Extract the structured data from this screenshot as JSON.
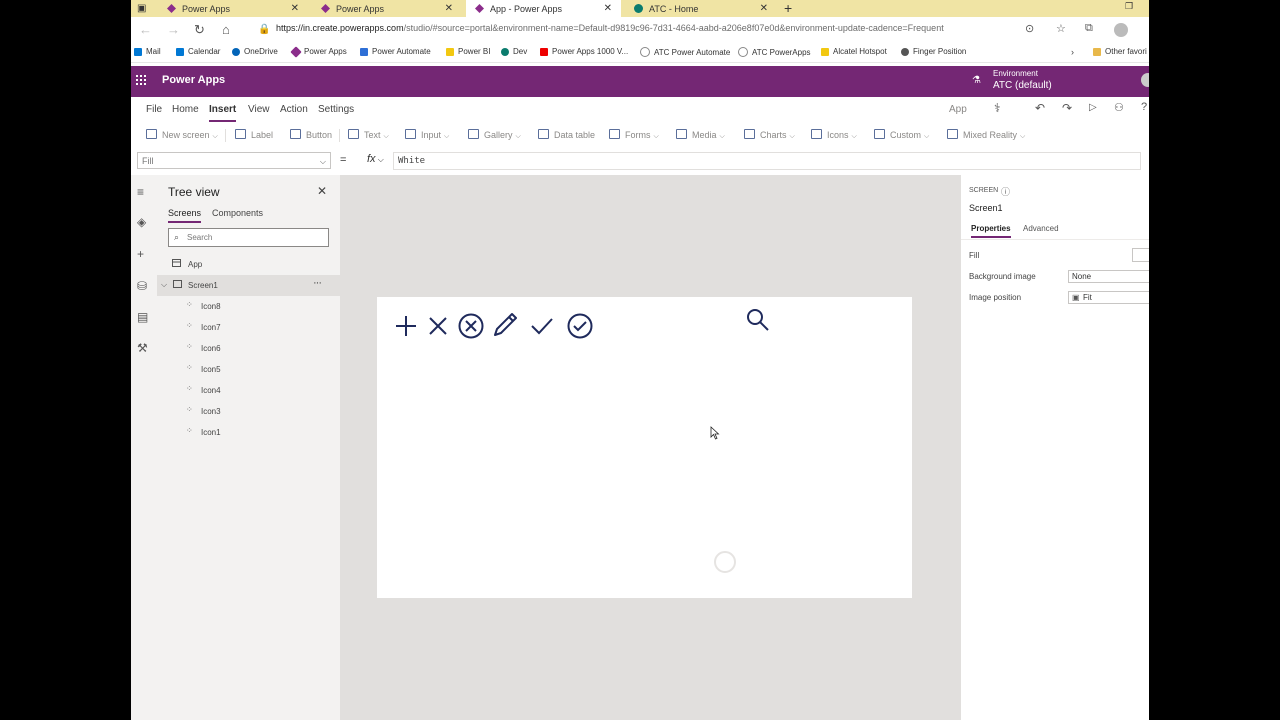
{
  "browser": {
    "tabs": [
      {
        "title": "Power Apps",
        "active": false
      },
      {
        "title": "Power Apps",
        "active": false
      },
      {
        "title": "App - Power Apps",
        "active": true
      },
      {
        "title": "ATC - Home",
        "active": false
      }
    ],
    "new_tab": "+",
    "url_host": "https://in.create.powerapps.com",
    "url_rest": "/studio/#source=portal&environment-name=Default-d9819c96-7d31-4664-aabd-a206e8f07e0d&environment-update-cadence=Frequent",
    "favorites": [
      "Mail",
      "Calendar",
      "OneDrive",
      "Power Apps",
      "Power Automate",
      "Power BI",
      "Dev",
      "Power Apps 1000 V...",
      "ATC Power Automate",
      "ATC PowerApps",
      "Alcatel Hotspot",
      "Finger Position"
    ],
    "favorites_more": "Other favori"
  },
  "app": {
    "name": "Power Apps",
    "env_label": "Environment",
    "env_value": "ATC (default)"
  },
  "menu": {
    "items": [
      "File",
      "Home",
      "Insert",
      "View",
      "Action",
      "Settings"
    ],
    "active": "Insert",
    "app_label": "App"
  },
  "ribbon": [
    "New screen",
    "Label",
    "Button",
    "Text",
    "Input",
    "Gallery",
    "Data table",
    "Forms",
    "Media",
    "Charts",
    "Icons",
    "Custom",
    "Mixed Reality"
  ],
  "formula": {
    "property": "Fill",
    "fx": "fx",
    "value": "White"
  },
  "tree": {
    "title": "Tree view",
    "tabs": [
      "Screens",
      "Components"
    ],
    "search_placeholder": "Search",
    "app_item": "App",
    "screen_item": "Screen1",
    "more": "···",
    "children": [
      "Icon8",
      "Icon7",
      "Icon6",
      "Icon5",
      "Icon4",
      "Icon3",
      "Icon1"
    ]
  },
  "canvas": {
    "icons": [
      "add-icon",
      "cancel-icon",
      "cancel-badge-icon",
      "edit-icon",
      "check-icon",
      "check-badge-icon",
      "search-icon"
    ]
  },
  "props": {
    "caption": "SCREEN",
    "name": "Screen1",
    "tabs": [
      "Properties",
      "Advanced"
    ],
    "fill_label": "Fill",
    "bg_label": "Background image",
    "bg_value": "None",
    "pos_label": "Image position",
    "pos_value": "Fit"
  },
  "colors": {
    "brand": "#742774",
    "tabstrip": "#f0e4a4",
    "icon_navy": "#1f2a5c"
  }
}
